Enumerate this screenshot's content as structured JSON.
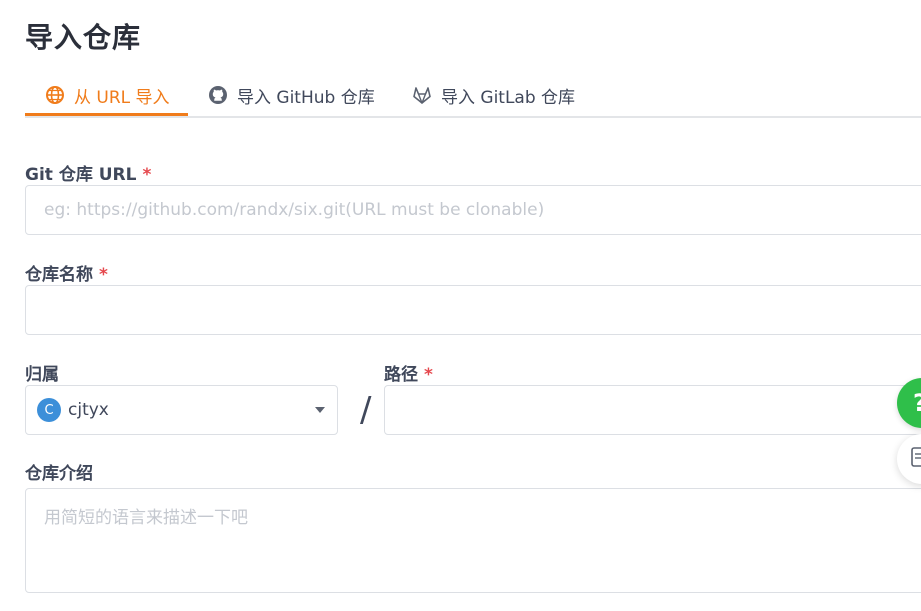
{
  "page": {
    "title": "导入仓库"
  },
  "tabs": [
    {
      "label": "从 URL 导入",
      "icon": "globe-icon",
      "active": true
    },
    {
      "label": "导入 GitHub 仓库",
      "icon": "github-icon",
      "active": false
    },
    {
      "label": "导入 GitLab 仓库",
      "icon": "gitlab-icon",
      "active": false
    }
  ],
  "form": {
    "git_url": {
      "label": "Git 仓库 URL",
      "required_mark": "*",
      "placeholder": "eg: https://github.com/randx/six.git(URL must be clonable)",
      "value": ""
    },
    "repo_name": {
      "label": "仓库名称",
      "required_mark": "*",
      "value": ""
    },
    "owner": {
      "label": "归属",
      "avatar_letter": "C",
      "selected": "cjtyx"
    },
    "separator": "/",
    "path": {
      "label": "路径",
      "required_mark": "*",
      "value": ""
    },
    "description": {
      "label": "仓库介绍",
      "placeholder": "用简短的语言来描述一下吧",
      "value": ""
    }
  },
  "floating": {
    "help_icon": "?"
  },
  "colors": {
    "accent": "#f07c1b",
    "required": "#e5484d",
    "help_button": "#2fbf4a",
    "avatar": "#3c8fd9"
  }
}
